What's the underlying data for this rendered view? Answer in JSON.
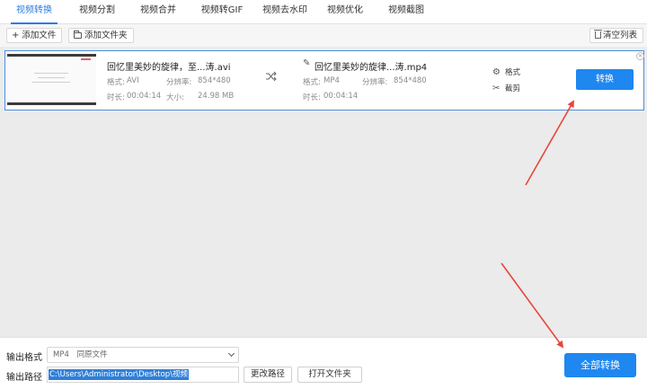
{
  "tabs": [
    {
      "label": "视频转换",
      "active": true
    },
    {
      "label": "视频分割"
    },
    {
      "label": "视频合并"
    },
    {
      "label": "视频转GIF"
    },
    {
      "label": "视频去水印"
    },
    {
      "label": "视频优化"
    },
    {
      "label": "视频截图"
    }
  ],
  "toolbar": {
    "add_file": "添加文件",
    "add_folder": "添加文件夹",
    "clear_list": "清空列表"
  },
  "file": {
    "source": {
      "name": "回忆里美妙的旋律，至...涛.avi",
      "format_label": "格式:",
      "format": "AVI",
      "resolution_label": "分辨率:",
      "resolution": "854*480",
      "duration_label": "时长:",
      "duration": "00:04:14",
      "size_label": "大小:",
      "size": "24.98 MB"
    },
    "output": {
      "name": "回忆里美妙的旋律...涛.mp4",
      "format_label": "格式:",
      "format": "MP4",
      "resolution_label": "分辨率:",
      "resolution": "854*480",
      "duration_label": "时长:",
      "duration": "00:04:14"
    },
    "actions": {
      "format": "格式",
      "cut": "截剪"
    },
    "convert_label": "转换"
  },
  "bottom": {
    "format_label": "输出格式",
    "format_value": "MP4",
    "format_note": "同原文件",
    "path_label": "输出路径",
    "path_value": "C:\\Users\\Administrator\\Desktop\\视频",
    "change_path": "更改路径",
    "open_folder": "打开文件夹",
    "convert_all": "全部转换"
  },
  "colors": {
    "accent": "#1e87f0",
    "annotation_arrow": "#e8453c"
  },
  "icons": [
    "plus-icon",
    "folder-icon",
    "trash-icon",
    "pencil-icon",
    "shuffle-icon",
    "gear-icon",
    "scissors-icon",
    "close-icon",
    "chevron-down-icon"
  ]
}
